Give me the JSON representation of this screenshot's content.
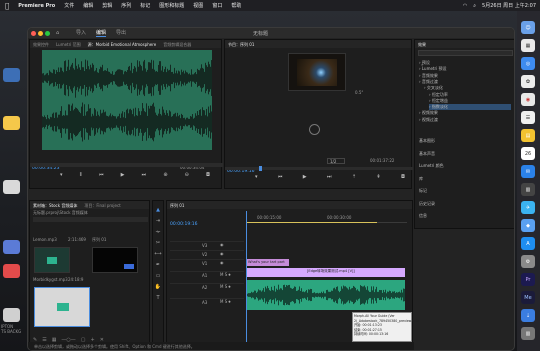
{
  "menubar": {
    "app_name": "Premiere Pro",
    "items": [
      "文件",
      "编辑",
      "剪辑",
      "序列",
      "标记",
      "图形和标题",
      "视图",
      "窗口",
      "帮助"
    ],
    "clock": "5月26日 周日 上午2:07"
  },
  "window": {
    "title": "无标题",
    "workspaces": [
      "导入",
      "编辑",
      "导出"
    ],
    "active_workspace": "编辑"
  },
  "source": {
    "tabs": [
      "效果控件",
      "Lumetri 范围",
      "源：Morbid Emotional Atmosphere",
      "音频剪辑混合器"
    ],
    "timecode_in": "00:00:34:23",
    "timecode_out": "00:00:34:04"
  },
  "program": {
    "tab": "节目：序列 01",
    "timecode": "00:00:19:16",
    "fit": "1/2",
    "duration": "00:01:37:22",
    "zoom_text": "0.5°"
  },
  "effects": {
    "title": "效果",
    "items": [
      {
        "label": "预设",
        "indent": 0
      },
      {
        "label": "Lumetri 预设",
        "indent": 0
      },
      {
        "label": "音频效果",
        "indent": 0
      },
      {
        "label": "音频过渡",
        "indent": 0
      },
      {
        "label": "交叉淡化",
        "indent": 1
      },
      {
        "label": "恒定功率",
        "indent": 2
      },
      {
        "label": "恒定增益",
        "indent": 2
      },
      {
        "label": "指数淡化",
        "indent": 2,
        "selected": true
      },
      {
        "label": "视频效果",
        "indent": 0
      },
      {
        "label": "视频过渡",
        "indent": 0
      }
    ],
    "extra": [
      "基本图形",
      "基本声音",
      "Lumetri 颜色",
      "库",
      "标记",
      "历史记录",
      "信息"
    ]
  },
  "project": {
    "tabs": [
      "素材箱：Stock 音频媒体",
      "项目：Final project"
    ],
    "path": "无标题.prproj\\Stock 音频媒体",
    "items": [
      {
        "name": "Lemon.mp3",
        "dur": "2:11:469",
        "tag": "序列 01"
      },
      {
        "name": "Morbidkygst.mp3",
        "dur": "24:18:9"
      },
      {
        "name": "",
        "dur": ""
      }
    ]
  },
  "timeline": {
    "tab": "序列 01",
    "timecode": "00:00:19:16",
    "ruler": [
      "00:00:15:00",
      "00:00:30:00"
    ],
    "tracks": [
      "V3",
      "V2",
      "V1",
      "A1",
      "A2",
      "A3"
    ],
    "clips": [
      {
        "label": "What's your tart part",
        "track": "V2"
      },
      {
        "label": "[Edge转场效果测试.mp4 [V]]",
        "track": "V1"
      }
    ],
    "tooltip": [
      "Morph-All Your Guide (Ver 2)_Adobestock_789450380_preview.m4a",
      "开始: 00:01:13:23",
      "结束: 00:01:27:15",
      "持续时间: 00:00:13:16"
    ]
  },
  "status": {
    "text": "单击以选择剪辑，或拖动以选择多个剪辑。使用 Shift、Option 和 Cmd 键进行其他选择。"
  },
  "desktop": {
    "left_label": "IPTON\nTS BACKG"
  }
}
